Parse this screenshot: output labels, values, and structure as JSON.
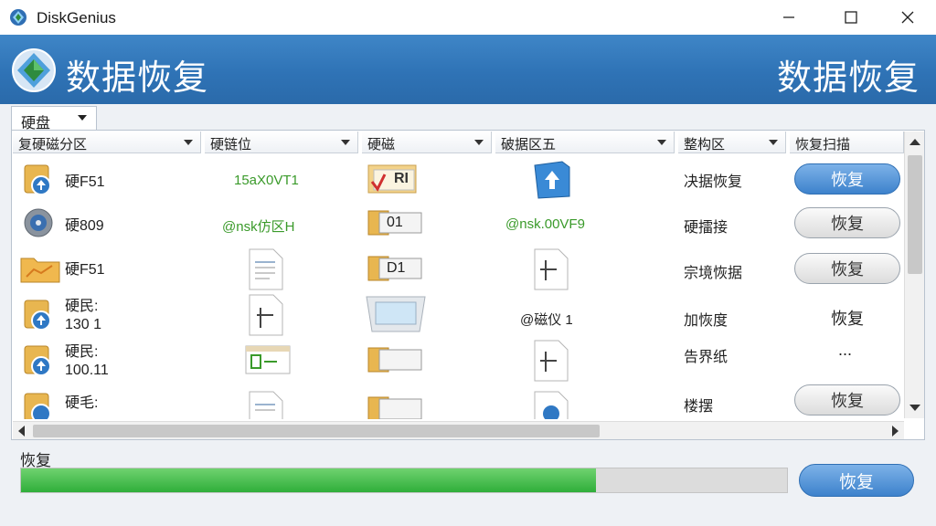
{
  "window": {
    "app_name": "DiskGenius",
    "minimize_icon": "minimize-icon",
    "maximize_icon": "maximize-icon",
    "close_icon": "close-icon"
  },
  "header": {
    "title": "数据恢复",
    "title_right": "数据恢复"
  },
  "filter": {
    "label": "硬盘"
  },
  "table": {
    "columns": [
      {
        "label": "复硬磁分区"
      },
      {
        "label": "硬链位"
      },
      {
        "label": "硬磁"
      },
      {
        "label": "破据区五"
      },
      {
        "label": "整构区"
      },
      {
        "label": "恢复扫描"
      }
    ],
    "rows": [
      {
        "name_line1": "硬F51",
        "name_line2": "",
        "green1": "15aX0VT1",
        "type_text": "RI",
        "green2": "",
        "status": "决据恢复",
        "action": "恢复",
        "action_style": "primary"
      },
      {
        "name_line1": "硬809",
        "name_line2": "",
        "green1": "@nsk仿区H",
        "type_text": "01",
        "green2": "@nsk.00VF9",
        "status": "硬擂接",
        "action": "恢复",
        "action_style": "secondary"
      },
      {
        "name_line1": "硬F51",
        "name_line2": "",
        "green1": "",
        "type_text": "D1",
        "green2": "",
        "status": "宗境恢据",
        "action": "恢复",
        "action_style": "secondary"
      },
      {
        "name_line1": "硬民:",
        "name_line2": "130 1",
        "green1": "",
        "type_text": "",
        "green2": "",
        "dark2": "@磁仪 1",
        "status": "加恢度",
        "action": "恢复",
        "action_style": "plain"
      },
      {
        "name_line1": "硬民:",
        "name_line2": "100.11",
        "green1": "",
        "type_text": "",
        "green2": "",
        "status": "告界纸",
        "action": "...",
        "action_style": "plain"
      },
      {
        "name_line1": "硬毛:",
        "name_line2": "",
        "green1": "",
        "type_text": "",
        "green2": "",
        "status": "楼摆",
        "action": "恢复",
        "action_style": "secondary"
      }
    ]
  },
  "progress": {
    "label": "恢复",
    "percent": 75,
    "button": "恢复"
  },
  "colors": {
    "header_blue": "#2f73b6",
    "progress_green": "#2fae3a",
    "button_blue": "#3d82cc"
  }
}
